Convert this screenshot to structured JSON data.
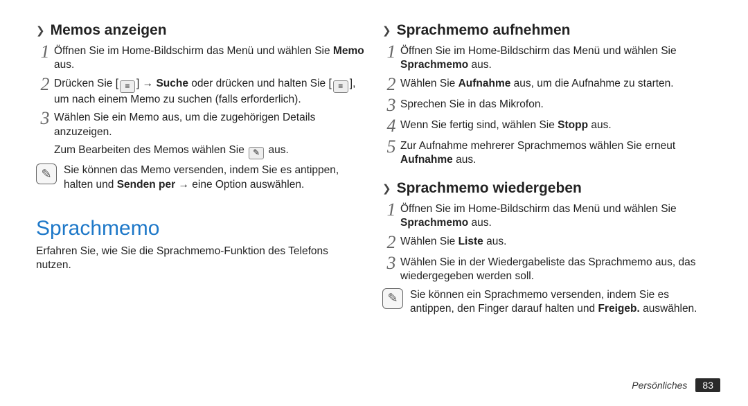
{
  "left": {
    "section_title": "Memos anzeigen",
    "steps": [
      {
        "num": "1",
        "text": "Öffnen Sie im Home-Bildschirm das Menü und wählen Sie ",
        "bold": "Memo",
        "after": " aus."
      },
      {
        "num": "2",
        "pre": "Drücken Sie [",
        "icon": "menu",
        "mid": "] → ",
        "bold": "Suche",
        "mid2": " oder drücken und halten Sie [",
        "icon2": "menu",
        "after": "], um nach einem Memo zu suchen (falls erforderlich)."
      },
      {
        "num": "3",
        "text": "Wählen Sie ein Memo aus, um die zugehörigen Details anzuzeigen."
      }
    ],
    "plain_line_pre": "Zum Bearbeiten des Memos wählen Sie ",
    "plain_line_post": " aus.",
    "note_pre": "Sie können das Memo versenden, indem Sie es antippen, halten und ",
    "note_bold": "Senden per",
    "note_post": " → eine Option auswählen.",
    "h1": "Sprachmemo",
    "intro": "Erfahren Sie, wie Sie die Sprachmemo-Funktion des Telefons nutzen."
  },
  "right": {
    "section1_title": "Sprachmemo aufnehmen",
    "s1_steps": [
      {
        "num": "1",
        "text": "Öffnen Sie im Home-Bildschirm das Menü und wählen Sie ",
        "bold": "Sprachmemo",
        "after": " aus."
      },
      {
        "num": "2",
        "text": "Wählen Sie ",
        "bold": "Aufnahme",
        "after": " aus, um die Aufnahme zu starten."
      },
      {
        "num": "3",
        "text": "Sprechen Sie in das Mikrofon."
      },
      {
        "num": "4",
        "text": "Wenn Sie fertig sind, wählen Sie ",
        "bold": "Stopp",
        "after": " aus."
      },
      {
        "num": "5",
        "text": "Zur Aufnahme mehrerer Sprachmemos wählen Sie erneut ",
        "bold": "Aufnahme",
        "after": " aus."
      }
    ],
    "section2_title": "Sprachmemo wiedergeben",
    "s2_steps": [
      {
        "num": "1",
        "text": "Öffnen Sie im Home-Bildschirm das Menü und wählen Sie ",
        "bold": "Sprachmemo",
        "after": " aus."
      },
      {
        "num": "2",
        "text": "Wählen Sie ",
        "bold": "Liste",
        "after": " aus."
      },
      {
        "num": "3",
        "text": "Wählen Sie in der Wiedergabeliste das Sprachmemo aus, das wiedergegeben werden soll."
      }
    ],
    "note_pre": "Sie können ein Sprachmemo versenden, indem Sie es antippen, den Finger darauf halten und ",
    "note_bold": "Freigeb.",
    "note_post": " auswählen."
  },
  "footer": {
    "category": "Persönliches",
    "page": "83"
  },
  "glyphs": {
    "chevron": "❯",
    "menu": "≡",
    "edit": "✎",
    "note": "⃠"
  }
}
